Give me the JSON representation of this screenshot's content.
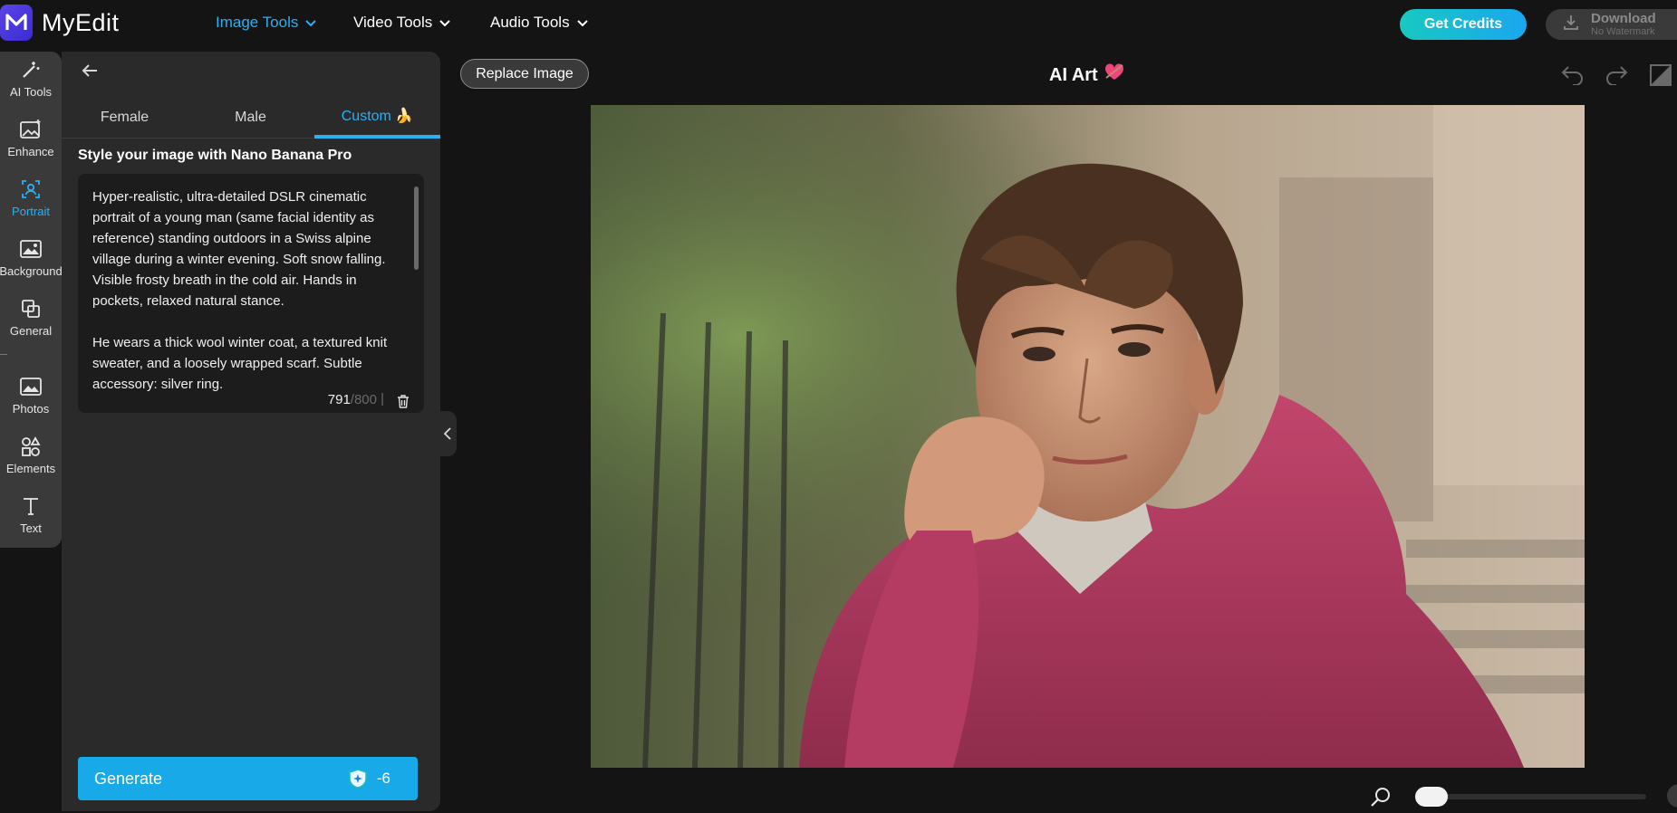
{
  "brand": {
    "name": "MyEdit",
    "accent": "#2ab0f5"
  },
  "nav": [
    {
      "label": "Image Tools",
      "active": true
    },
    {
      "label": "Video Tools",
      "active": false
    },
    {
      "label": "Audio Tools",
      "active": false
    }
  ],
  "header": {
    "credits_label": "Get Credits",
    "download_label": "Download",
    "download_sub": "No Watermark"
  },
  "rail": {
    "items": [
      {
        "label": "AI Tools",
        "icon": "magic-wand-icon"
      },
      {
        "label": "Enhance",
        "icon": "image-sparkle-icon"
      },
      {
        "label": "Portrait",
        "icon": "portrait-icon",
        "active": true
      },
      {
        "label": "Background",
        "icon": "background-icon"
      },
      {
        "label": "General",
        "icon": "general-icon"
      },
      {
        "label": "Photos",
        "icon": "photos-icon"
      },
      {
        "label": "Elements",
        "icon": "elements-icon"
      },
      {
        "label": "Text",
        "icon": "text-icon"
      }
    ]
  },
  "panel": {
    "tabs": [
      {
        "label": "Female"
      },
      {
        "label": "Male"
      },
      {
        "label": "Custom 🍌",
        "active": true
      }
    ],
    "heading": "Style your image with Nano Banana Pro",
    "prompt": "Hyper-realistic, ultra-detailed DSLR cinematic portrait of a young man (same facial identity as reference) standing outdoors in a Swiss alpine village during a winter evening. Soft snow falling. Visible frosty breath in the cold air. Hands in pockets, relaxed natural stance.\n\nHe wears a thick wool winter coat, a textured knit sweater, and a loosely wrapped scarf. Subtle accessory: silver ring.",
    "char_count": "791",
    "char_max": "/800",
    "generate_label": "Generate",
    "generate_cost": "-6"
  },
  "canvas": {
    "replace_label": "Replace Image",
    "title": "AI Art",
    "title_icon": "heart-icon"
  }
}
